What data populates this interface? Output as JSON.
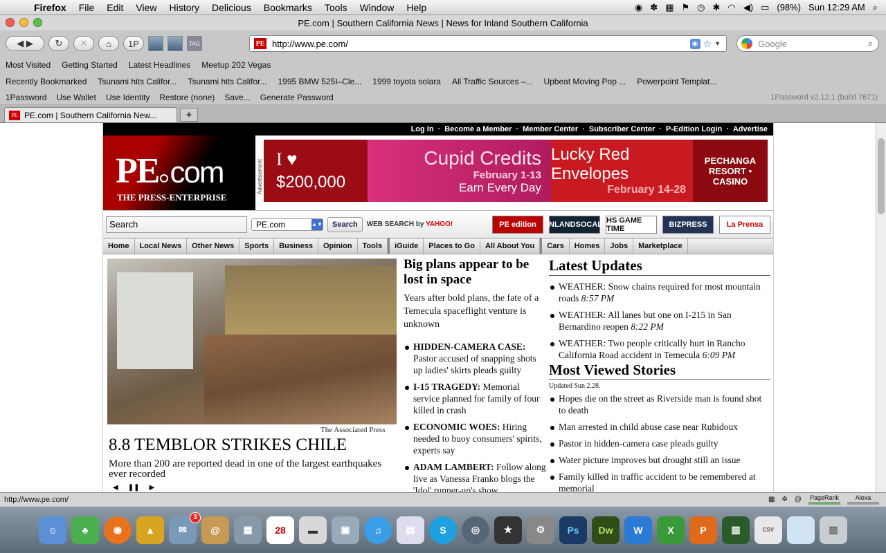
{
  "menubar": {
    "app_name": "Firefox",
    "items": [
      "File",
      "Edit",
      "View",
      "History",
      "Delicious",
      "Bookmarks",
      "Tools",
      "Window",
      "Help"
    ],
    "battery": "(98%)",
    "clock": "Sun 12:29 AM"
  },
  "window": {
    "title": "PE.com | Southern California News | News for Inland Southern California"
  },
  "toolbar": {
    "onep_label": "1P",
    "tag_label": "TAG",
    "url": "http://www.pe.com/",
    "search_placeholder": "Google"
  },
  "bookmarks_row1": [
    "Most Visited",
    "Getting Started",
    "Latest Headlines",
    "Meetup 202 Vegas"
  ],
  "bookmarks_row2": [
    "Recently Bookmarked",
    "Tsunami hits Califor...",
    "Tsunami hits Califor...",
    "1995 BMW 525I–Cle...",
    "1999 toyota solara",
    "All Traffic Sources –...",
    "Upbeat Moving Pop ...",
    "Powerpoint Templat..."
  ],
  "onepassword": {
    "items": [
      "1Password",
      "Use Wallet",
      "Use Identity",
      "Restore (none)",
      "Save...",
      "Generate Password"
    ],
    "version": "1Password v2.12.1 (build 7671)"
  },
  "tab": {
    "title": "PE.com | Southern California New..."
  },
  "site": {
    "top_links": [
      "Log In",
      "Become a Member",
      "Member Center",
      "Subscriber Center",
      "P-Edition Login",
      "Advertise"
    ],
    "logo_pe": "PE",
    "logo_com": "com",
    "tagline": "THE PRESS-ENTERPRISE",
    "ad_label": "Advertisement",
    "ad": {
      "love": "I ♥",
      "amount": "$200,000",
      "cupid_title": "Cupid Credits",
      "cupid_dates": "February 1-13",
      "cupid_sub": "Earn Every Day",
      "lucky_title": "Lucky Red Envelopes",
      "lucky_dates": "February 14-28",
      "casino": "PECHANGA RESORT • CASINO"
    },
    "search_placeholder": "Search",
    "scope": "PE.com",
    "search_button": "Search",
    "web_search": "WEB SEARCH by",
    "yahoo": "YAHOO!",
    "partners": [
      "PE edition",
      "INLANDSOCAL",
      "HS GAME TIME",
      "BIZPRESS",
      "La Prensa"
    ],
    "nav": [
      "Home",
      "Local News",
      "Other News",
      "Sports",
      "Business",
      "Opinion",
      "Tools",
      "iGuide",
      "Places to Go",
      "All About You",
      "Cars",
      "Homes",
      "Jobs",
      "Marketplace"
    ],
    "lead": {
      "credit": "The Associated Press",
      "headline": "8.8 TEMBLOR STRIKES CHILE",
      "dek": "More than 200 are reported dead in one of the largest earthquakes ever recorded"
    },
    "feature": {
      "headline": "Big plans appear to be lost in space",
      "sub": "Years after bold plans, the fate of a Temecula spaceflight venture is unknown",
      "stories": [
        {
          "kicker": "HIDDEN-CAMERA CASE:",
          "text": " Pastor accused of snapping shots up ladies' skirts pleads guilty"
        },
        {
          "kicker": "I-15 TRAGEDY:",
          "text": " Memorial service planned for family of four killed in crash"
        },
        {
          "kicker": "ECONOMIC WOES:",
          "text": " Hiring needed to buoy consumers' spirits, experts say"
        },
        {
          "kicker": "ADAM LAMBERT:",
          "text": " Follow along live as Vanessa Franko blogs the 'Idol' runner-up's show"
        }
      ]
    },
    "latest": {
      "title": "Latest Updates",
      "items": [
        {
          "text": "WEATHER: Snow chains required for most mountain roads ",
          "time": "8:57 PM"
        },
        {
          "text": "WEATHER: All lanes but one on I-215 in San Bernardino reopen ",
          "time": "8:22 PM"
        },
        {
          "text": "WEATHER: Two people critically hurt in Rancho California Road accident in Temecula ",
          "time": "6:09 PM"
        }
      ]
    },
    "most_viewed": {
      "title": "Most Viewed Stories",
      "updated": "Updated Sun 2.28.",
      "items": [
        "Hopes die on the street as Riverside man is found shot to death",
        "Man arrested in child abuse case near Rubidoux",
        "Pastor in hidden-camera case pleads guilty",
        "Water picture improves but drought still an issue",
        "Family killed in traffic accident to be remembered at memorial"
      ]
    }
  },
  "statusbar": {
    "url": "http://www.pe.com/",
    "pagerank": "PageRank",
    "alexa": "Alexa"
  },
  "dock": {
    "calendar_day": "28",
    "mail_badge": "3",
    "ps": "Ps",
    "dw": "Dw",
    "csv": "CSV"
  }
}
